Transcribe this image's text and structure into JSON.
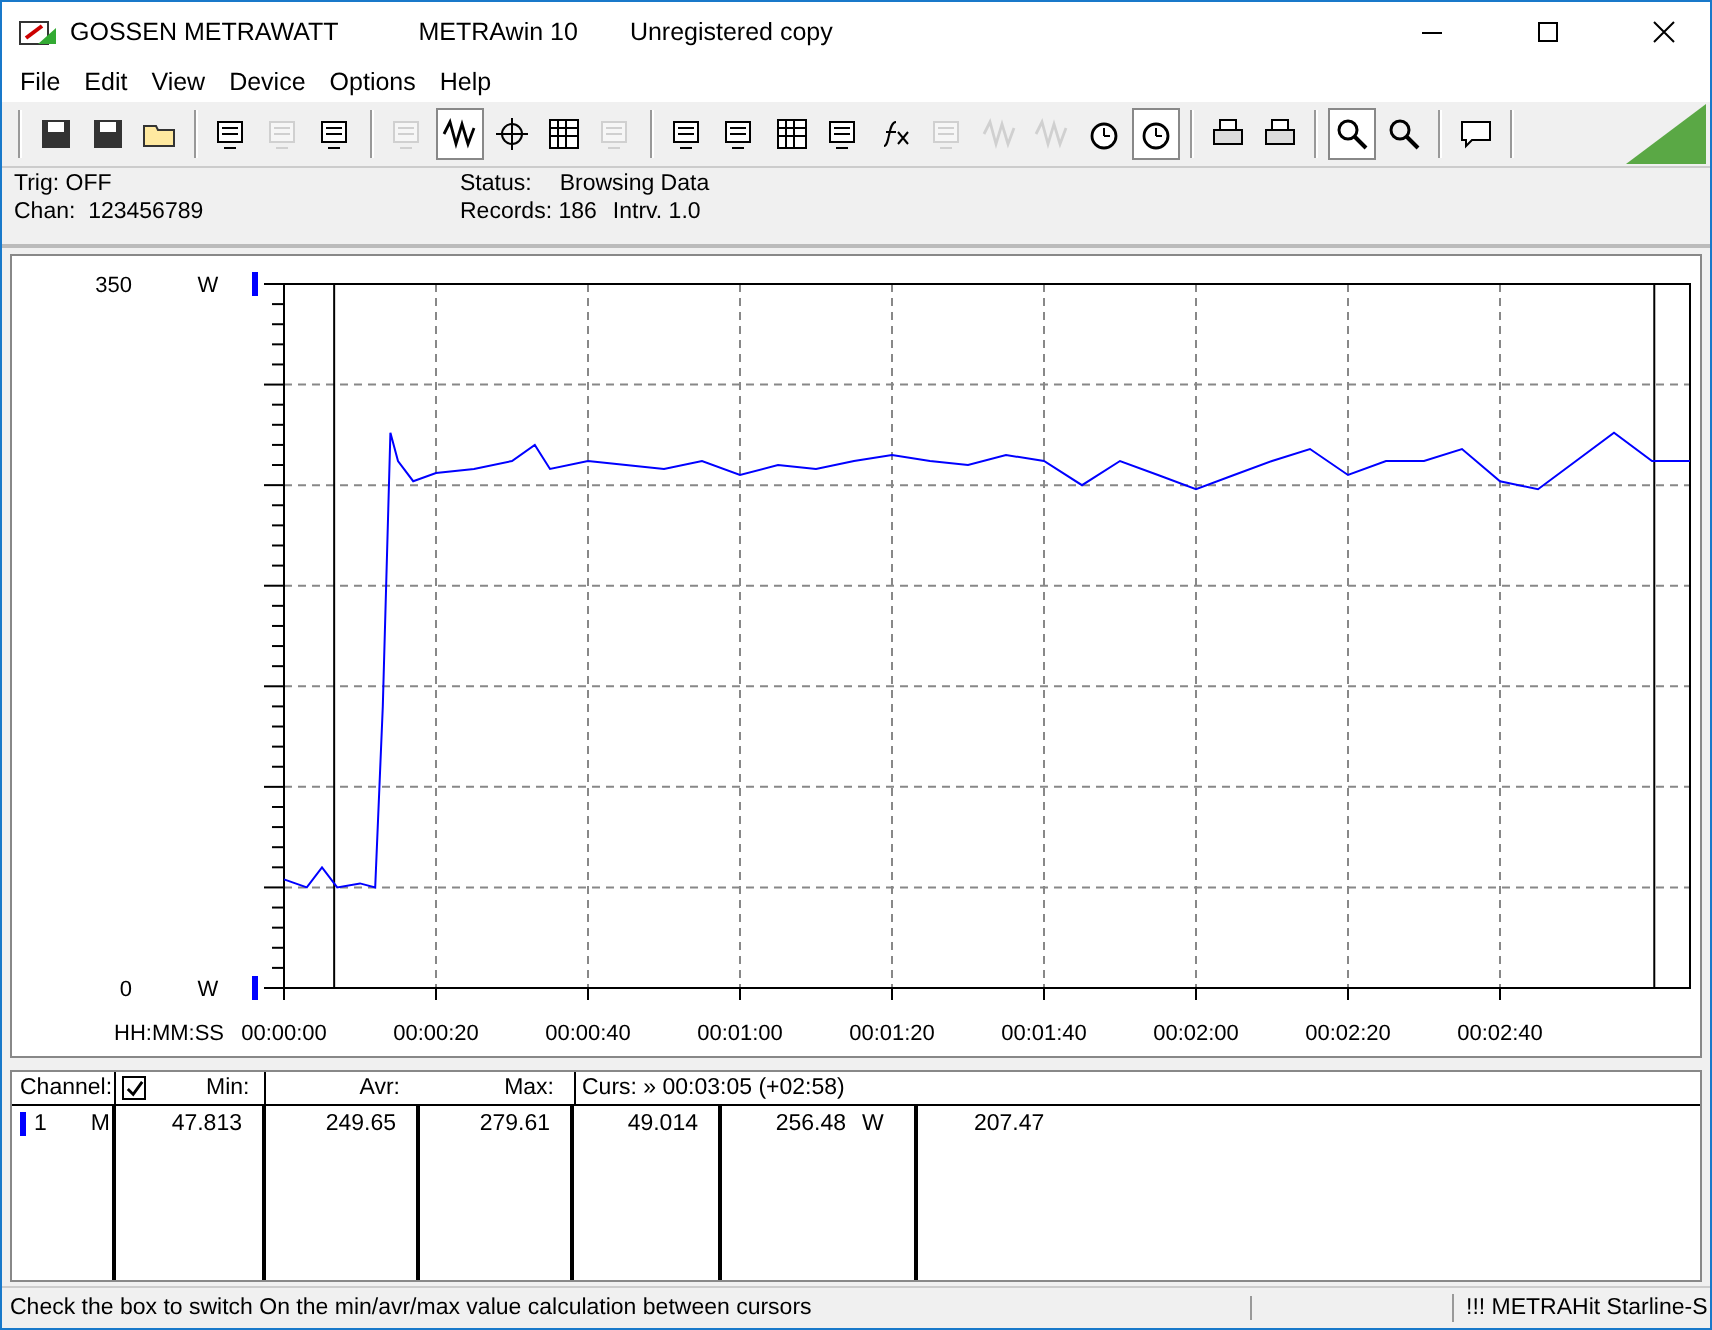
{
  "window": {
    "app_name": "GOSSEN METRAWATT",
    "title": "METRAwin 10",
    "license": "Unregistered copy"
  },
  "menu": [
    "File",
    "Edit",
    "View",
    "Device",
    "Options",
    "Help"
  ],
  "toolbar": [
    [
      {
        "pressed": false,
        "disabled": false
      },
      {
        "pressed": false,
        "disabled": false
      },
      {
        "pressed": false,
        "disabled": false
      }
    ],
    [
      {
        "pressed": false,
        "disabled": false
      },
      {
        "pressed": false,
        "disabled": true
      },
      {
        "pressed": false,
        "disabled": false
      }
    ],
    [
      {
        "pressed": false,
        "disabled": true
      },
      {
        "pressed": true,
        "disabled": false
      },
      {
        "pressed": false,
        "disabled": false
      },
      {
        "pressed": false,
        "disabled": false
      },
      {
        "pressed": false,
        "disabled": true
      }
    ],
    [
      {
        "pressed": false,
        "disabled": false
      },
      {
        "pressed": false,
        "disabled": false
      },
      {
        "pressed": false,
        "disabled": false
      },
      {
        "pressed": false,
        "disabled": false
      },
      {
        "pressed": false,
        "disabled": false
      },
      {
        "pressed": false,
        "disabled": true
      },
      {
        "pressed": false,
        "disabled": true
      },
      {
        "pressed": false,
        "disabled": true
      },
      {
        "pressed": false,
        "disabled": false
      },
      {
        "pressed": true,
        "disabled": false
      }
    ],
    [
      {
        "pressed": false,
        "disabled": false
      },
      {
        "pressed": false,
        "disabled": false
      }
    ],
    [
      {
        "pressed": true,
        "disabled": false
      },
      {
        "pressed": false,
        "disabled": false
      }
    ],
    [
      {
        "pressed": false,
        "disabled": false
      }
    ]
  ],
  "info": {
    "trigger": "Trig: OFF",
    "channels": "Chan:  123456789",
    "status_label": "Status:",
    "status_value": "Browsing Data",
    "records": "Records: 186",
    "interval": "Intrv. 1.0"
  },
  "chart": {
    "unit_top": "W",
    "unit_bottom": "W",
    "chart_data": {
      "type": "line",
      "xlabel": "HH:MM:SS",
      "x": [
        0,
        3,
        5,
        7,
        10,
        12,
        13,
        14,
        15,
        17,
        20,
        25,
        30,
        33,
        35,
        40,
        45,
        50,
        55,
        60,
        65,
        70,
        75,
        80,
        85,
        90,
        95,
        100,
        105,
        110,
        115,
        120,
        125,
        130,
        135,
        140,
        145,
        150,
        155,
        160,
        165,
        170,
        175,
        180,
        185
      ],
      "series": [
        {
          "color": "#0000ff",
          "values": [
            54,
            50,
            60,
            50,
            52,
            50,
            140,
            276,
            262,
            252,
            256,
            258,
            262,
            270,
            258,
            262,
            260,
            258,
            262,
            255,
            260,
            258,
            262,
            265,
            262,
            260,
            265,
            262,
            250,
            262,
            255,
            248,
            255,
            262,
            268,
            255,
            262,
            262,
            268,
            252,
            248,
            262,
            276,
            262,
            262
          ]
        }
      ],
      "grid": true,
      "ref_lines": [
        {
          "axis": "x",
          "value": 6.6
        },
        {
          "axis": "x",
          "value": 180.3
        }
      ],
      "xlim": [
        0,
        185
      ],
      "ylim": [
        0,
        350
      ],
      "xticks": [
        {
          "value": 0,
          "label": "00:00:00"
        },
        {
          "value": 20,
          "label": "00:00:20"
        },
        {
          "value": 40,
          "label": "00:00:40"
        },
        {
          "value": 60,
          "label": "00:01:00"
        },
        {
          "value": 80,
          "label": "00:01:20"
        },
        {
          "value": 100,
          "label": "00:01:40"
        },
        {
          "value": 120,
          "label": "00:02:00"
        },
        {
          "value": 140,
          "label": "00:02:20"
        },
        {
          "value": 160,
          "label": "00:02:40"
        }
      ],
      "yticks": [
        {
          "value": 0,
          "label": "0"
        },
        {
          "value": 350,
          "label": "350"
        }
      ]
    }
  },
  "table": {
    "channel_header": "Channel:",
    "calc_checked": true,
    "columns": [
      "Min:",
      "Avr:",
      "Max:"
    ],
    "cursor_header": "Curs: » 00:03:05 (+02:58)",
    "rows": [
      {
        "channel": "1",
        "type": "M",
        "color": "#0000ff",
        "min": "47.813",
        "avr": "249.65",
        "max": "279.61",
        "cursor_1": "49.014",
        "cursor_2": "256.48",
        "unit": "W",
        "cursor_3": "207.47"
      }
    ]
  },
  "status_bar": {
    "hint": "Check the box to switch On the min/avr/max value calculation between cursors",
    "device": "!!! METRAHit Starline-S"
  }
}
